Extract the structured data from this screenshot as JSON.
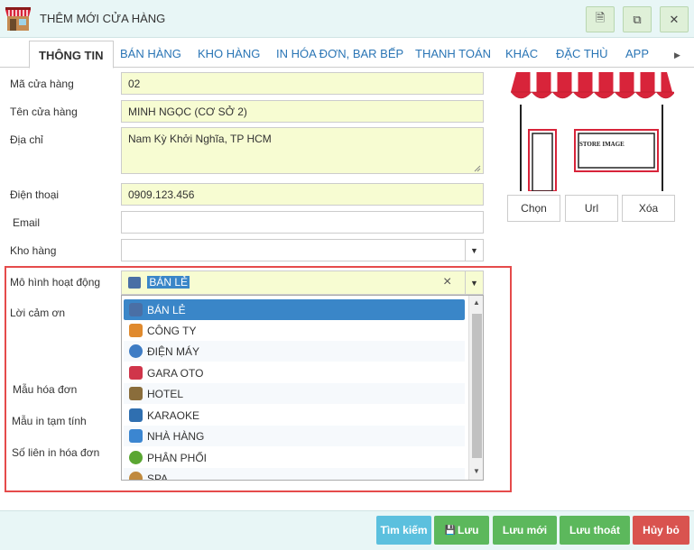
{
  "window": {
    "title": "THÊM MỚI CỬA HÀNG"
  },
  "title_buttons": {
    "doc": "🗎",
    "copy": "⧉",
    "close": "✕"
  },
  "tabs": [
    "THÔNG TIN",
    "BÁN HÀNG",
    "KHO HÀNG",
    "IN HÓA ĐƠN, BAR BẾP",
    "THANH TOÁN",
    "KHÁC",
    "ĐẶC THÙ",
    "APP"
  ],
  "tab_scroll": "▶",
  "form": {
    "store_code": {
      "label": "Mã cửa hàng",
      "value": "02"
    },
    "store_name": {
      "label": "Tên cửa hàng",
      "value": "MINH NGỌC (CƠ SỞ 2)"
    },
    "address": {
      "label": "Địa chỉ",
      "value": "Nam Kỳ Khởi Nghĩa, TP HCM"
    },
    "phone": {
      "label": "Điện thoại",
      "value": "0909.123.456"
    },
    "email": {
      "label": "Email",
      "value": ""
    },
    "warehouse": {
      "label": "Kho hàng",
      "value": "",
      "arrow": "▼"
    },
    "business_model": {
      "label": "Mô hình hoạt động",
      "value": "BÁN LẺ",
      "clear": "×",
      "arrow": "▼"
    },
    "thanks": {
      "label": "Lời cảm ơn"
    },
    "invoice_template": {
      "label": "Mẫu hóa đơn"
    },
    "temp_print": {
      "label": "Mẫu in tạm tính"
    },
    "invoice_copies": {
      "label": "Số liên in hóa đơn"
    }
  },
  "store_image": {
    "caption": "STORE IMAGE",
    "awning_color": "#d8243a"
  },
  "image_buttons": {
    "choose": "Chọn",
    "url": "Url",
    "delete": "Xóa"
  },
  "dropdown_options": [
    {
      "label": "BÁN LẺ",
      "icon": "computer-icon",
      "color": "#4a6fa5"
    },
    {
      "label": "CÔNG TY",
      "icon": "company-icon",
      "color": "#e08a2e"
    },
    {
      "label": "ĐIỆN MÁY",
      "icon": "person-icon",
      "color": "#3e7cc4"
    },
    {
      "label": "GARA OTO",
      "icon": "car-icon",
      "color": "#d0354a"
    },
    {
      "label": "HOTEL",
      "icon": "hotel-icon",
      "color": "#8a6d3b"
    },
    {
      "label": "KARAOKE",
      "icon": "guitar-icon",
      "color": "#2f6fb0"
    },
    {
      "label": "NHÀ HÀNG",
      "icon": "restaurant-icon",
      "color": "#3b86d1"
    },
    {
      "label": "PHÂN PHỐI",
      "icon": "apple-icon",
      "color": "#5aa632"
    },
    {
      "label": "SPA",
      "icon": "spa-icon",
      "color": "#c08a3e"
    }
  ],
  "footer_buttons": {
    "search": {
      "label": "Tìm kiếm",
      "color": "#5bc0de"
    },
    "save": {
      "label": "Lưu",
      "icon": "💾",
      "color": "#5cb85c"
    },
    "save_new": {
      "label": "Lưu mới",
      "color": "#5cb85c"
    },
    "save_exit": {
      "label": "Lưu thoát",
      "color": "#5cb85c"
    },
    "cancel": {
      "label": "Hủy bỏ",
      "color": "#d9534f"
    }
  }
}
